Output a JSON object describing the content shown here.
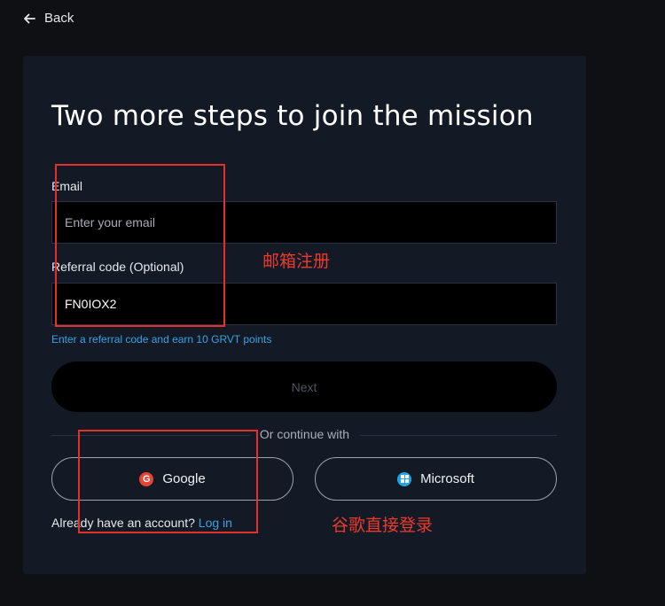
{
  "nav": {
    "back_label": "Back"
  },
  "form": {
    "title": "Two more steps to join the mission",
    "email_label": "Email",
    "email_placeholder": "Enter your email",
    "email_value": "",
    "referral_label": "Referral code (Optional)",
    "referral_value": "FN0IOX2",
    "referral_hint": "Enter a referral code and earn 10 GRVT points",
    "next_label": "Next",
    "divider_text": "Or continue with",
    "google_label": "Google",
    "microsoft_label": "Microsoft",
    "account_prompt": "Already have an account?",
    "login_label": "Log in"
  },
  "annotations": {
    "email_note": "邮箱注册",
    "google_note": "谷歌直接登录"
  },
  "colors": {
    "background": "#0f1014",
    "card": "#131a26",
    "accent": "#35a4e6",
    "annotation": "#e5312a",
    "google": "#e84436",
    "microsoft": "#1ea7e8"
  }
}
